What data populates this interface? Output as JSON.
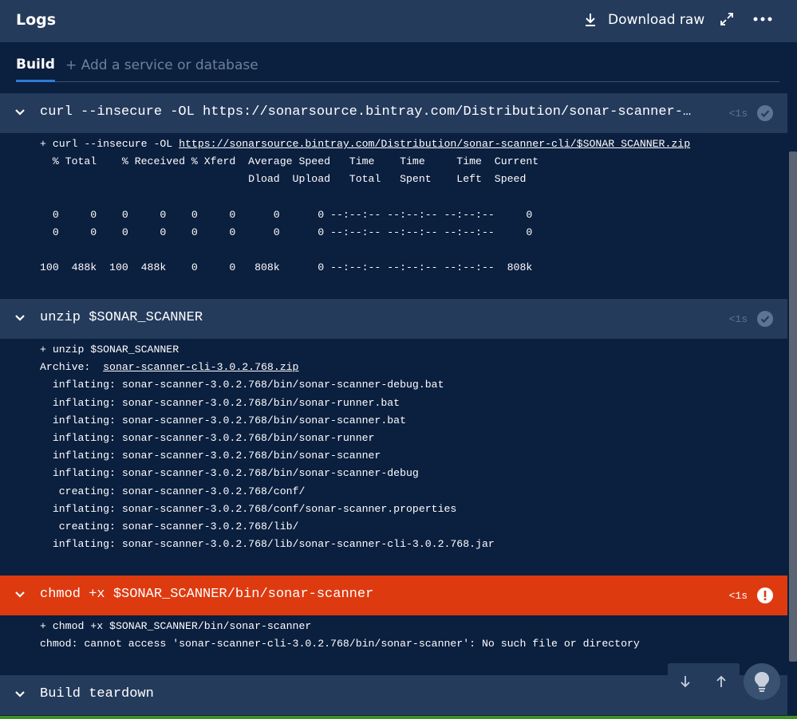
{
  "header": {
    "title": "Logs",
    "download_label": "Download raw",
    "download_icon": "download-icon",
    "expand_icon": "expand-icon",
    "more_icon": "more-icon"
  },
  "tabs": {
    "build": "Build",
    "add": "+ Add a service or database"
  },
  "steps": [
    {
      "command": "curl --insecure -OL https://sonarsource.bintray.com/Distribution/sonar-scanner-cli/$SONAR_SCANNER.zip",
      "duration": "<1s",
      "status": "success"
    },
    {
      "command": "unzip $SONAR_SCANNER",
      "duration": "<1s",
      "status": "success"
    },
    {
      "command": "chmod +x $SONAR_SCANNER/bin/sonar-scanner",
      "duration": "<1s",
      "status": "error"
    },
    {
      "command": "Build teardown",
      "duration": "",
      "status": "pending"
    }
  ],
  "logs": {
    "curl": {
      "prefix": "\u0001+ curl --insecure -OL ",
      "link": "https://sonarsource.bintray.com/Distribution/sonar-scanner-cli/$SONAR_SCANNER.zip",
      "lines": [
        "  % Total    % Received % Xferd  Average Speed   Time    Time     Time  Current",
        "                                 Dload  Upload   Total   Spent    Left  Speed",
        "",
        "  0     0    0     0    0     0      0      0 --:--:-- --:--:-- --:--:--     0",
        "  0     0    0     0    0     0      0      0 --:--:-- --:--:-- --:--:--     0",
        "",
        "100  488k  100  488k    0     0   808k      0 --:--:-- --:--:-- --:--:--  808k"
      ]
    },
    "unzip": {
      "first": "\u0001+ unzip $SONAR_SCANNER",
      "archive_prefix": "Archive:  ",
      "archive_link": "sonar-scanner-cli-3.0.2.768.zip",
      "lines": [
        "  inflating: sonar-scanner-3.0.2.768/bin/sonar-scanner-debug.bat",
        "  inflating: sonar-scanner-3.0.2.768/bin/sonar-runner.bat",
        "  inflating: sonar-scanner-3.0.2.768/bin/sonar-scanner.bat",
        "  inflating: sonar-scanner-3.0.2.768/bin/sonar-runner",
        "  inflating: sonar-scanner-3.0.2.768/bin/sonar-scanner",
        "  inflating: sonar-scanner-3.0.2.768/bin/sonar-scanner-debug",
        "   creating: sonar-scanner-3.0.2.768/conf/",
        "  inflating: sonar-scanner-3.0.2.768/conf/sonar-scanner.properties",
        "   creating: sonar-scanner-3.0.2.768/lib/",
        "  inflating: sonar-scanner-3.0.2.768/lib/sonar-scanner-cli-3.0.2.768.jar"
      ]
    },
    "chmod": {
      "lines": [
        "\u0001+ chmod +x $SONAR_SCANNER/bin/sonar-scanner",
        "chmod: cannot access 'sonar-scanner-cli-3.0.2.768/bin/sonar-scanner': No such file or directory"
      ]
    }
  },
  "floating": {
    "scroll_down_icon": "arrow-down-icon",
    "scroll_up_icon": "arrow-up-icon",
    "tips_icon": "lightbulb-icon"
  },
  "colors": {
    "background": "#0b1f3f",
    "header": "#243b5c",
    "error": "#de3a10",
    "success_icon": "#5f7393",
    "tab_underline": "#2f7ad6"
  }
}
